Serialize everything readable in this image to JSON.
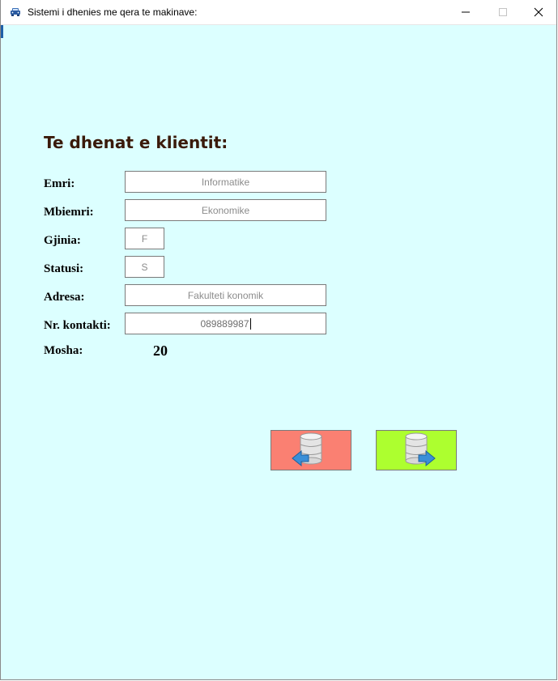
{
  "window": {
    "title": "Sistemi i dhenies me qera te makinave:",
    "icons": [
      "car-icon",
      "minimize-icon",
      "maximize-icon",
      "close-icon"
    ]
  },
  "form": {
    "heading": "Te dhenat e klientit:",
    "fields": {
      "emri": {
        "label": "Emri:",
        "value": "Informatike"
      },
      "mbiemri": {
        "label": "Mbiemri:",
        "value": "Ekonomike"
      },
      "gjinia": {
        "label": "Gjinia:",
        "value": "F"
      },
      "statusi": {
        "label": "Statusi:",
        "value": "S"
      },
      "adresa": {
        "label": "Adresa:",
        "value": "Fakulteti konomik"
      },
      "kontakti": {
        "label": "Nr. kontakti:",
        "value": "089889987"
      }
    },
    "mosha": {
      "label": "Mosha:",
      "value": "20"
    }
  },
  "buttons": {
    "back": {
      "icon": "database-back-icon",
      "color": "#fa8072"
    },
    "next": {
      "icon": "database-forward-icon",
      "color": "#adff2f"
    }
  },
  "colors": {
    "background": "#dcffff",
    "heading": "#3a1a0a"
  }
}
